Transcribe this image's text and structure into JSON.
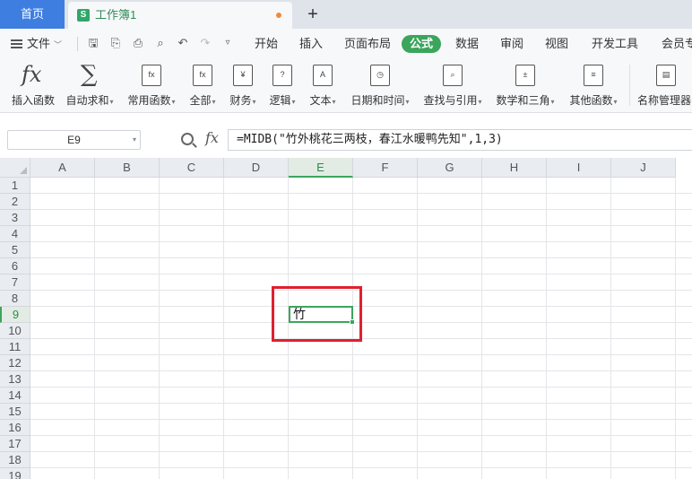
{
  "tabs": {
    "home": "首页",
    "doc_title": "工作簿1",
    "doc_icon_glyph": "S"
  },
  "menubar": {
    "file_label": "文件",
    "tabs": [
      "开始",
      "插入",
      "页面布局",
      "公式",
      "数据",
      "审阅",
      "视图",
      "开发工具",
      "会员专享"
    ],
    "active_tab": "公式"
  },
  "ribbon": {
    "buttons": [
      {
        "label": "插入函数",
        "icon": "fx-icon"
      },
      {
        "label": "自动求和",
        "icon": "sigma-icon"
      },
      {
        "label": "常用函数",
        "icon": "star-function-icon"
      },
      {
        "label": "全部",
        "icon": "fx-box-icon"
      },
      {
        "label": "财务",
        "icon": "yen-icon"
      },
      {
        "label": "逻辑",
        "icon": "question-icon"
      },
      {
        "label": "文本",
        "icon": "text-a-icon"
      },
      {
        "label": "日期和时间",
        "icon": "clock-icon"
      },
      {
        "label": "查找与引用",
        "icon": "find-icon"
      },
      {
        "label": "数学和三角",
        "icon": "math-icon"
      },
      {
        "label": "其他函数",
        "icon": "more-functions-icon"
      },
      {
        "label": "名称管理器",
        "icon": "name-manager-icon"
      }
    ]
  },
  "formula_bar": {
    "name_box": "E9",
    "fx_label": "fx",
    "formula": "=MIDB(\"竹外桃花三两枝，春江水暖鸭先知\",1,3)"
  },
  "sheet": {
    "columns": [
      "A",
      "B",
      "C",
      "D",
      "E",
      "F",
      "G",
      "H",
      "I",
      "J"
    ],
    "rows": [
      "1",
      "2",
      "3",
      "4",
      "5",
      "6",
      "7",
      "8",
      "9",
      "10",
      "11",
      "12",
      "13",
      "14",
      "15",
      "16",
      "17",
      "18",
      "19"
    ],
    "selected_column": "E",
    "selected_row": "9",
    "active_cell_value": "竹"
  },
  "colors": {
    "accent_green": "#3ca55c",
    "home_tab_blue": "#3e7ee0",
    "highlight_red": "#e0202e"
  }
}
